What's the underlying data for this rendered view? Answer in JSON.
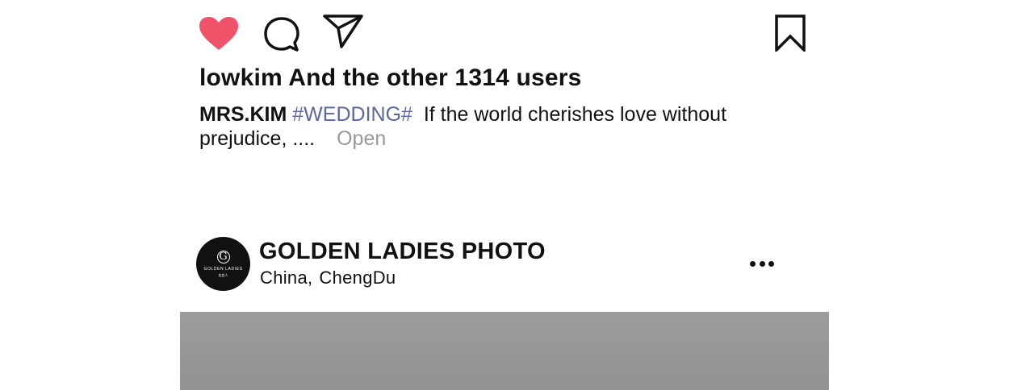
{
  "actions": {
    "like_icon": "heart-filled-icon",
    "comment_icon": "speech-bubble-icon",
    "share_icon": "paper-plane-icon",
    "save_icon": "bookmark-icon",
    "like_color": "#f0526a"
  },
  "likes": {
    "text": "lowkim And the other 1314 users"
  },
  "caption": {
    "author": "MRS.KIM",
    "hashtag": "#WEDDING#",
    "text": "If the world cherishes love without prejudice, ....",
    "more_label": "Open",
    "hashtag_color": "#5a67a0"
  },
  "post": {
    "avatar": {
      "logo_mark": "G",
      "logo_text": "GOLDEN LADIES",
      "logo_sub": "金女人"
    },
    "account_name": "GOLDEN LADIES PHOTO",
    "location_country": "China,",
    "location_city": "ChengDu",
    "more_icon": "more-horizontal-icon"
  }
}
